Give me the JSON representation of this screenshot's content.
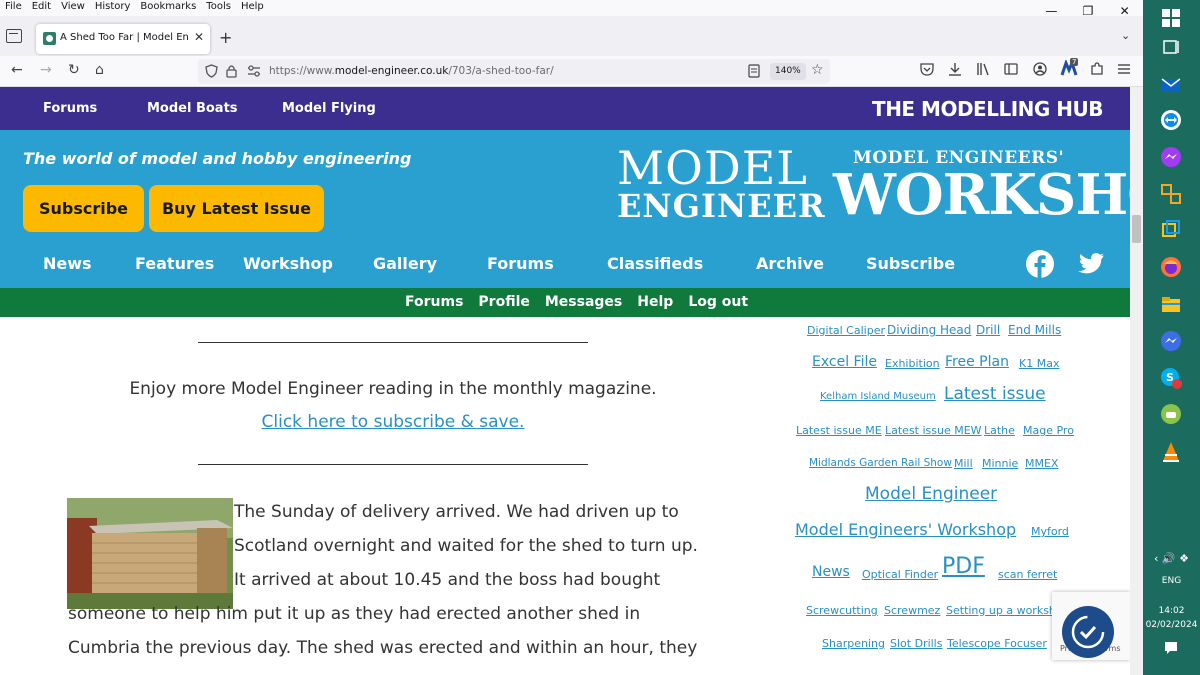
{
  "browser": {
    "menu": [
      "File",
      "Edit",
      "View",
      "History",
      "Bookmarks",
      "Tools",
      "Help"
    ],
    "window_controls": {
      "minimize": "—",
      "restore": "❐",
      "close": "✕"
    },
    "tab": {
      "title": "A Shed Too Far | Model Engineer",
      "close": "✕"
    },
    "new_tab": "+",
    "list_all_tabs": "⌄",
    "nav": {
      "back": "←",
      "forward": "→",
      "reload": "↻",
      "home": "⌂"
    },
    "url": {
      "prefix": "https://www.",
      "host": "model-engineer.co.uk",
      "path": "/703/a-shed-too-far/"
    },
    "zoom": "140%",
    "extension_badge": "7"
  },
  "site": {
    "hub_links": [
      "Forums",
      "Model Boats",
      "Model Flying"
    ],
    "hub_title": "THE MODELLING HUB",
    "tagline": "The world of model and hobby engineering",
    "subscribe_btn": "Subscribe",
    "buy_btn": "Buy Latest Issue",
    "logo_me": {
      "line1": "MODEL",
      "line2": "ENGINEER"
    },
    "logo_mew": {
      "line1": "MODEL ENGINEERS'",
      "line2": "WORKSHOP"
    },
    "main_nav": [
      "News",
      "Features",
      "Workshop",
      "Gallery",
      "Forums",
      "Classifieds",
      "Archive",
      "Subscribe"
    ],
    "user_links": [
      "Forums",
      "Profile",
      "Messages",
      "Help",
      "Log out"
    ]
  },
  "content": {
    "promo_text": "Enjoy more Model Engineer reading in the monthly magazine.",
    "promo_link": "Click here to subscribe & save.",
    "article": "The Sunday of delivery arrived. We had driven up to Scotland overnight and waited for the shed to turn up. It arrived at about 10.45 and the boss had bought someone to help him put it up as they had erected another shed in Cumbria the previous day. The shed was erected and within an hour, they"
  },
  "tags": [
    {
      "text": "Digital Caliper"
    },
    {
      "text": "Dividing Head"
    },
    {
      "text": "Drill"
    },
    {
      "text": "End Mills"
    },
    {
      "text": "Excel File"
    },
    {
      "text": "Exhibition"
    },
    {
      "text": "Free Plan"
    },
    {
      "text": "K1 Max"
    },
    {
      "text": "Kelham Island Museum"
    },
    {
      "text": "Latest issue"
    },
    {
      "text": "Latest issue ME"
    },
    {
      "text": "Latest issue MEW"
    },
    {
      "text": "Lathe"
    },
    {
      "text": "Mage Pro"
    },
    {
      "text": "Midlands Garden Rail Show"
    },
    {
      "text": "Mill"
    },
    {
      "text": "Minnie"
    },
    {
      "text": "MMEX"
    },
    {
      "text": "Model Engineer"
    },
    {
      "text": "Model Engineers' Workshop"
    },
    {
      "text": "Myford"
    },
    {
      "text": "News"
    },
    {
      "text": "Optical Finder"
    },
    {
      "text": "PDF"
    },
    {
      "text": "scan ferret"
    },
    {
      "text": "Screwcutting"
    },
    {
      "text": "Screwmez"
    },
    {
      "text": "Setting up a workshop"
    },
    {
      "text": "Sharpening"
    },
    {
      "text": "Slot Drills"
    },
    {
      "text": "Telescope Focuser"
    }
  ],
  "recaptcha_text": "Privacy - Terms",
  "taskbar": {
    "language": "ENG",
    "time": "14:02",
    "date": "02/02/2024"
  },
  "colors": {
    "hub_purple": "#3b2e8e",
    "hero_blue": "#2aa0d0",
    "button_yellow": "#fcb900",
    "user_green": "#0f7a3b",
    "link_blue": "#2a8fc5",
    "taskbar": "#1c6b5f"
  }
}
